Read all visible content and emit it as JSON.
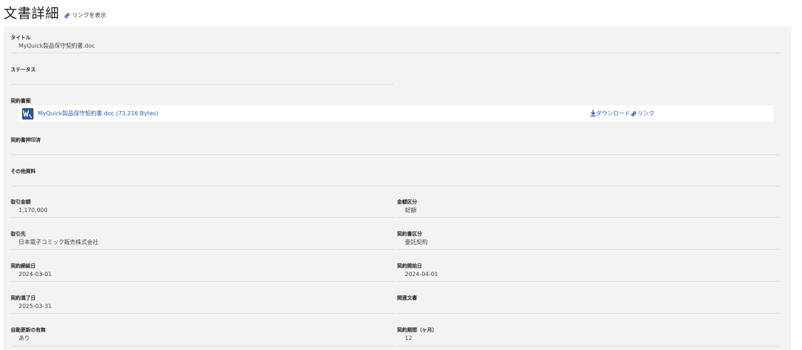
{
  "header": {
    "title": "文書詳細",
    "show_link_label": "リンクを表示"
  },
  "fields": {
    "title": {
      "label": "タイトル",
      "value": "MyQuick製品保守契約書.doc"
    },
    "status": {
      "label": "ステータス",
      "value": ""
    },
    "draft": {
      "label": "契約書案",
      "file_icon": "word-document-icon",
      "file_name": "MyQuick製品保守契約書.doc (73,216 Bytes)",
      "download_label": "ダウンロード",
      "link_label": "リンク"
    },
    "sealed": {
      "label": "契約書押印済",
      "value": ""
    },
    "other": {
      "label": "その他資料",
      "value": ""
    },
    "amount": {
      "label": "取引金額",
      "value": "1,170,000"
    },
    "amount_type": {
      "label": "金額区分",
      "value": "総額"
    },
    "partner": {
      "label": "取引先",
      "value": "日本電子コミック販売株式会社"
    },
    "contract_type": {
      "label": "契約書区分",
      "value": "委託契約"
    },
    "sign_date": {
      "label": "契約締結日",
      "value": "2024-03-01"
    },
    "start_date": {
      "label": "契約開始日",
      "value": "2024-04-01"
    },
    "end_date": {
      "label": "契約満了日",
      "value": "2025-03-31"
    },
    "related": {
      "label": "関連文書",
      "value": ""
    },
    "auto_renew": {
      "label": "自動更新の有無",
      "value": "あり"
    },
    "period": {
      "label": "契約期間（ヶ月）",
      "value": "12"
    }
  },
  "colors": {
    "link": "#2b5cb0",
    "panel_bg": "#f3f3f3",
    "word_icon": "#2b5797"
  }
}
